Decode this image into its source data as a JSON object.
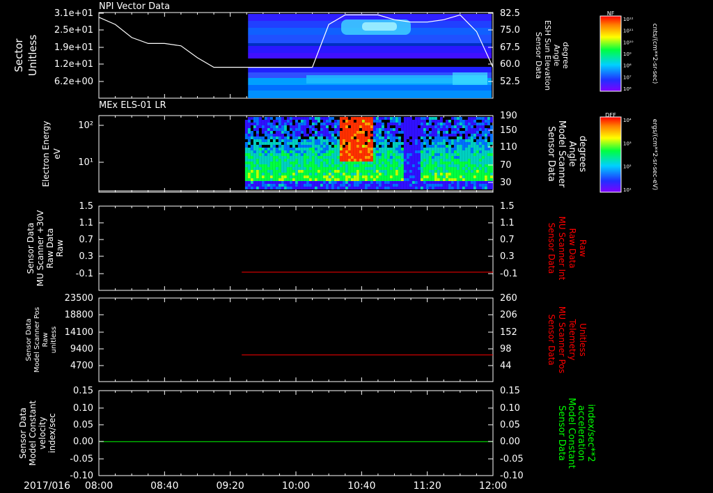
{
  "panels": [
    {
      "title": "NPI Vector Data",
      "left_label": [
        "Sector",
        "Unitless"
      ],
      "left_ticks": [
        "3.1e+01",
        "2.5e+01",
        "1.9e+01",
        "1.2e+01",
        "6.2e+00"
      ],
      "right_label": [
        "Sensor Data",
        "ESH Sun Elevation",
        "Angle",
        "degree"
      ],
      "right_ticks": [
        "82.5",
        "75.0",
        "67.5",
        "60.0",
        "52.5"
      ],
      "colorbar_title": "NF",
      "colorbar_ticks": [
        "10¹²",
        "10¹¹",
        "10¹⁰",
        "10⁹",
        "10⁸",
        "10⁷",
        "10⁶"
      ],
      "colorbar_unit": "cnts/(cm**2-sr-sec)"
    },
    {
      "title": "MEx ELS-01 LR",
      "left_label": [
        "Electron Energy",
        "eV"
      ],
      "left_ticks": [
        "10²",
        "10¹"
      ],
      "right_label": [
        "Sensor Data",
        "Model Scanner",
        "Angle",
        "degrees"
      ],
      "right_ticks": [
        "190",
        "150",
        "110",
        "70",
        "30"
      ],
      "colorbar_title": "DEF",
      "colorbar_ticks": [
        "10⁴",
        "10³",
        "10²",
        "10¹"
      ],
      "colorbar_unit": "ergs/(cm**2-sr-sec-eV)"
    },
    {
      "left_label": [
        "Sensor Data",
        "MU Scanner +30V",
        "Raw Data",
        "Raw"
      ],
      "left_ticks": [
        "1.5",
        "1.1",
        "0.7",
        "0.3",
        "-0.1"
      ],
      "right_label": [
        "Sensor Data",
        "MU Scanner Int",
        "Raw Data",
        "Raw"
      ],
      "right_ticks": [
        "1.5",
        "1.1",
        "0.7",
        "0.3",
        "-0.1"
      ]
    },
    {
      "left_label": [
        "Sensor Data",
        "Model Scanner Pos",
        "Raw",
        "unitless"
      ],
      "left_ticks": [
        "23500",
        "18800",
        "14100",
        "9400",
        "4700"
      ],
      "right_label": [
        "Sensor Data",
        "MU Scanner Pos",
        "Telemetry",
        "Unitless"
      ],
      "right_ticks": [
        "260",
        "206",
        "152",
        "98",
        "44"
      ]
    },
    {
      "left_label": [
        "Sensor Data",
        "Model Constant",
        "velocity",
        "index/sec"
      ],
      "left_ticks": [
        "0.15",
        "0.10",
        "0.05",
        "0.00",
        "-0.05",
        "-0.10"
      ],
      "right_label": [
        "Sensor Data",
        "Model Constant",
        "acceleration",
        "index/sec**2"
      ],
      "right_ticks": [
        "0.15",
        "0.10",
        "0.05",
        "0.00",
        "-0.05",
        "-0.10"
      ]
    }
  ],
  "x_axis": {
    "date": "2017/016",
    "ticks": [
      "08:00",
      "08:40",
      "09:20",
      "10:00",
      "10:40",
      "11:20",
      "12:00"
    ]
  },
  "colors": {
    "background": "#000000",
    "right_label_red": "#ff0000",
    "right_label_green": "#00ff00",
    "trace_red": "#ff0000",
    "trace_green": "#00ff00",
    "trace_white": "#ffffff"
  },
  "chart_data": [
    {
      "type": "heatmap",
      "title": "NPI Vector Data",
      "ylabel": "Sector Unitless",
      "y2label": "Sensor Data ESH Sun Elevation Angle degree",
      "time_range": [
        "08:00",
        "12:00"
      ],
      "data_start": "09:30",
      "y2lim": [
        47,
        83
      ],
      "overlay_series": {
        "name": "ESH Sun Elevation Angle",
        "color": "#ffffff",
        "x": [
          "08:00",
          "08:10",
          "08:20",
          "08:30",
          "08:40",
          "08:50",
          "09:00",
          "09:10",
          "09:20",
          "09:30",
          "09:40",
          "09:50",
          "10:00",
          "10:10",
          "10:20",
          "10:30",
          "10:40",
          "10:50",
          "11:00",
          "11:10",
          "11:20",
          "11:30",
          "11:40",
          "11:50",
          "12:00"
        ],
        "y": [
          81.0,
          78.0,
          72.5,
          70.0,
          70.0,
          69.0,
          64.0,
          60.0,
          60.0,
          60.0,
          60.0,
          60.0,
          60.0,
          60.0,
          78.0,
          82.0,
          82.0,
          82.0,
          80.0,
          79.0,
          79.0,
          80.0,
          82.0,
          75.0,
          60.0
        ]
      }
    },
    {
      "type": "heatmap",
      "title": "MEx ELS-01 LR",
      "ylabel": "Electron Energy eV",
      "y2label": "Sensor Data Model Scanner Angle degrees",
      "time_range": [
        "08:00",
        "12:00"
      ],
      "data_start": "09:29",
      "y2lim": [
        10,
        190
      ],
      "overlay_series": {
        "name": "Model Scanner Angle",
        "color": "#ffffff",
        "x": [
          "08:00",
          "12:00"
        ],
        "y": [
          13,
          13
        ]
      }
    },
    {
      "type": "line",
      "ylabel": "Sensor Data MU Scanner +30V Raw Data Raw",
      "y2label": "Sensor Data MU Scanner Int Raw Data Raw",
      "ylim": [
        -0.35,
        1.5
      ],
      "series": [
        {
          "name": "MU Scanner Int",
          "color": "#ff0000",
          "x": [
            "09:27",
            "12:00"
          ],
          "y": [
            0.05,
            0.05
          ]
        }
      ]
    },
    {
      "type": "line",
      "ylabel": "Sensor Data Model Scanner Pos Raw unitless",
      "y2label": "Sensor Data MU Scanner Pos Telemetry Unitless",
      "ylim": [
        0,
        23500
      ],
      "y2lim": [
        0,
        260
      ],
      "series": [
        {
          "name": "MU Scanner Pos",
          "color": "#ff0000",
          "x": [
            "09:27",
            "12:00"
          ],
          "y2": [
            83,
            83
          ]
        }
      ]
    },
    {
      "type": "line",
      "ylabel": "Sensor Data Model Constant velocity index/sec",
      "y2label": "Sensor Data Model Constant acceleration index/sec**2",
      "ylim": [
        -0.1,
        0.15
      ],
      "series": [
        {
          "name": "Model Constant",
          "color": "#00ff00",
          "x": [
            "08:00",
            "12:00"
          ],
          "y": [
            0.0,
            0.0
          ]
        }
      ]
    }
  ]
}
